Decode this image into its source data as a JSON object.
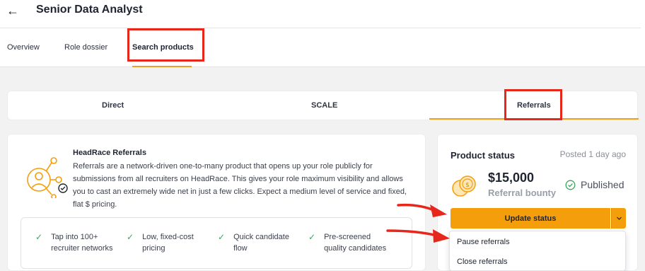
{
  "header": {
    "back_icon": "arrow-left-icon",
    "title": "Senior Data Analyst"
  },
  "nav_tabs": [
    {
      "label": "Overview",
      "active": false
    },
    {
      "label": "Role dossier",
      "active": false
    },
    {
      "label": "Search products",
      "active": true
    }
  ],
  "product_tabs": [
    {
      "label": "Direct",
      "active": false
    },
    {
      "label": "SCALE",
      "active": false
    },
    {
      "label": "Referrals",
      "active": true
    }
  ],
  "product": {
    "icon": "network-referral-icon",
    "name": "HeadRace Referrals",
    "description": "Referrals are a network-driven one-to-many product that opens up your role publicly for submissions from all recruiters on HeadRace. This gives your role maximum visibility and allows you to cast an extremely wide net in just a few clicks. Expect a medium level of service and fixed, flat $ pricing.",
    "features": [
      {
        "line1": "Tap into 100+",
        "line2": "recruiter networks"
      },
      {
        "line1": "Low, fixed-cost",
        "line2": "pricing"
      },
      {
        "line1": "Quick candidate",
        "line2": "flow"
      },
      {
        "line1": "Pre-screened",
        "line2": "quality candidates"
      }
    ]
  },
  "status": {
    "title": "Product status",
    "posted": "Posted 1 day ago",
    "bounty_amount": "$15,000",
    "bounty_label": "Referral bounty",
    "published_label": "Published",
    "update_button": "Update status",
    "menu_items": [
      "Pause referrals",
      "Close referrals"
    ]
  },
  "colors": {
    "accent": "#f59e0b",
    "highlight": "#e8271c",
    "success": "#3ba55c"
  }
}
